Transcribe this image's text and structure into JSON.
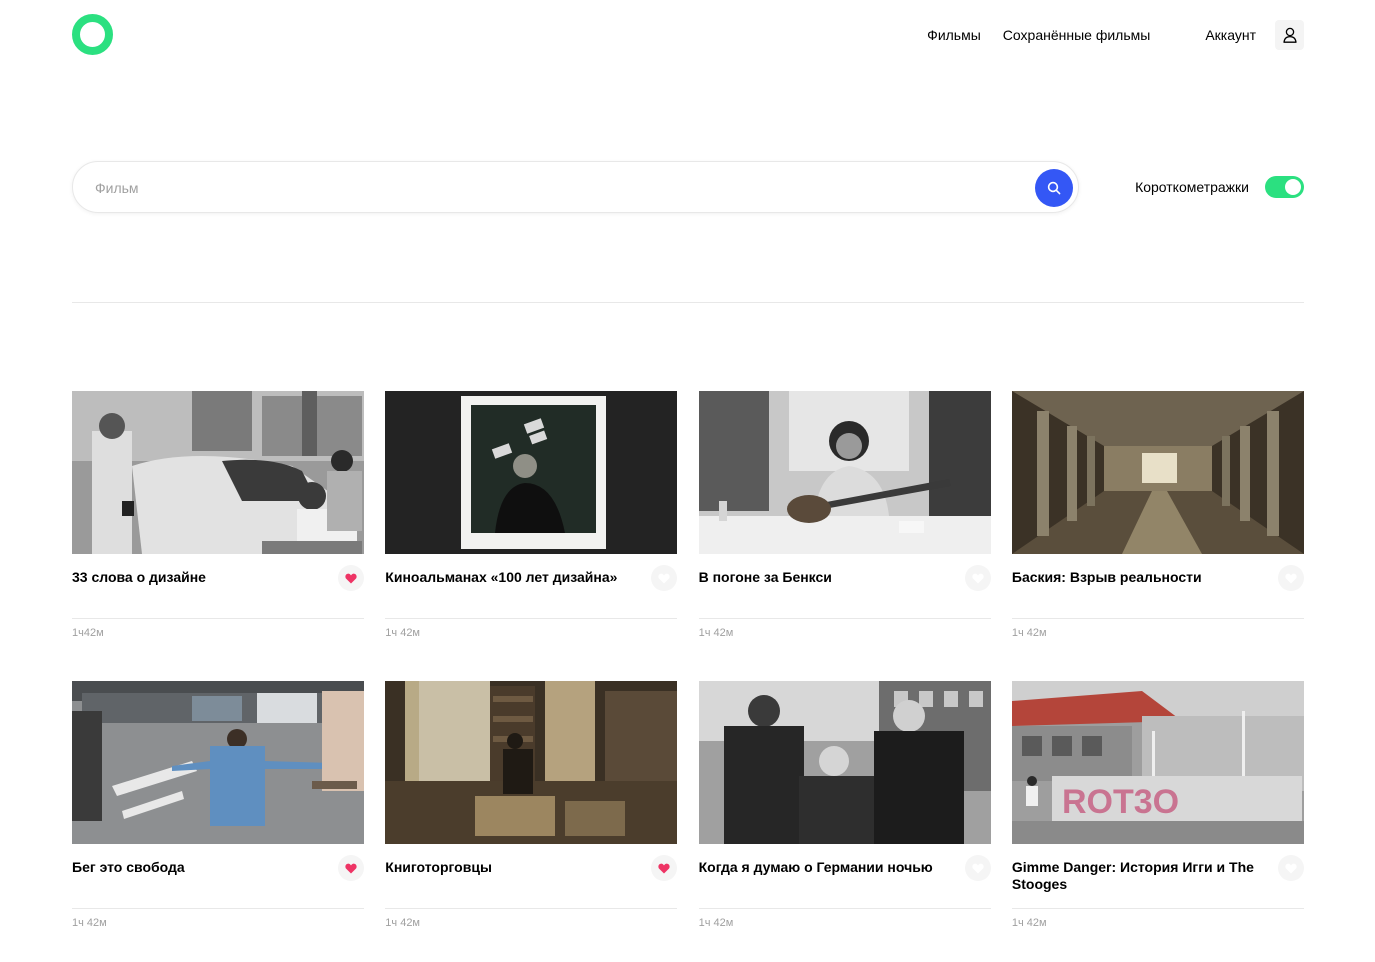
{
  "nav": {
    "films": "Фильмы",
    "saved": "Сохранённые фильмы",
    "account": "Аккаунт",
    "logo_icon": "ring-logo-icon",
    "account_icon": "user-icon"
  },
  "search": {
    "placeholder": "Фильм",
    "button_icon": "search-icon",
    "shorts_label": "Короткометражки",
    "shorts_enabled": true
  },
  "colors": {
    "accent_green": "#2be080",
    "search_blue": "#3457f5",
    "like_red": "#ee3465",
    "divider": "#e8e8e8"
  },
  "movies": [
    {
      "title": "33 слова о дизайне",
      "duration": "1ч42м",
      "liked": true
    },
    {
      "title": "Киноальманах «100 лет дизайна»",
      "duration": "1ч 42м",
      "liked": false
    },
    {
      "title": "В погоне за Бенкси",
      "duration": "1ч 42м",
      "liked": false
    },
    {
      "title": "Баския: Взрыв реальности",
      "duration": "1ч 42м",
      "liked": false
    },
    {
      "title": "Бег это свобода",
      "duration": "1ч 42м",
      "liked": true
    },
    {
      "title": "Книготорговцы",
      "duration": "1ч 42м",
      "liked": true
    },
    {
      "title": "Когда я думаю о Германии ночью",
      "duration": "1ч 42м",
      "liked": false
    },
    {
      "title": "Gimme Danger: История Игги и The Stooges",
      "duration": "1ч 42м",
      "liked": false
    }
  ]
}
